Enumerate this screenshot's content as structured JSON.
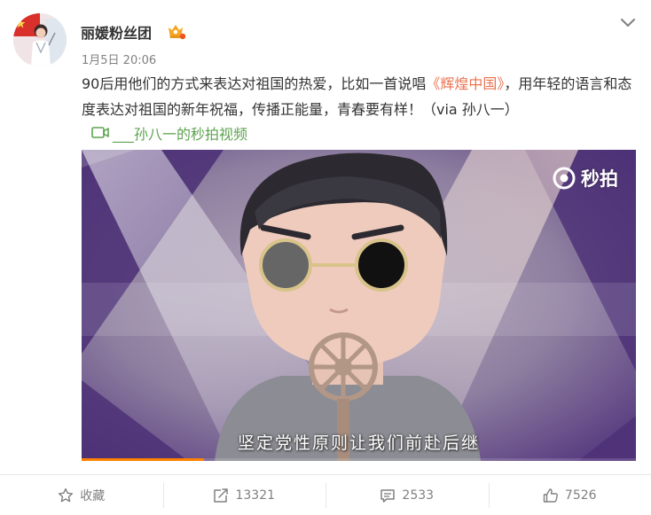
{
  "post": {
    "username": "丽媛粉丝团",
    "timestamp": "1月5日 20:06",
    "text_before": "90后用他们的方式来表达对祖国的热爱，比如一首说唱",
    "text_highlight": "《辉煌中国》",
    "text_after": "，用年轻的语言和态度表达对祖国的新年祝福，传播正能量，青春要有样！（via 孙八一）",
    "video_link": "___孙八一的秒拍视频",
    "highlight_color": "#eb7350",
    "link_color": "#5da34f"
  },
  "video": {
    "watermark": "秒拍",
    "subtitle": "坚定党性原则让我们前赴后继",
    "progress": 0.22,
    "progress_color": "#ff8200"
  },
  "actions": {
    "favorite": "收藏",
    "repost_count": "13321",
    "comment_count": "2533",
    "like_count": "7526"
  },
  "icons": [
    "avatar",
    "vip-crown-icon",
    "chevron-down-icon",
    "video-link-icon",
    "miaopai-logo-icon",
    "star-icon",
    "repost-icon",
    "comment-icon",
    "thumbs-up-icon"
  ]
}
